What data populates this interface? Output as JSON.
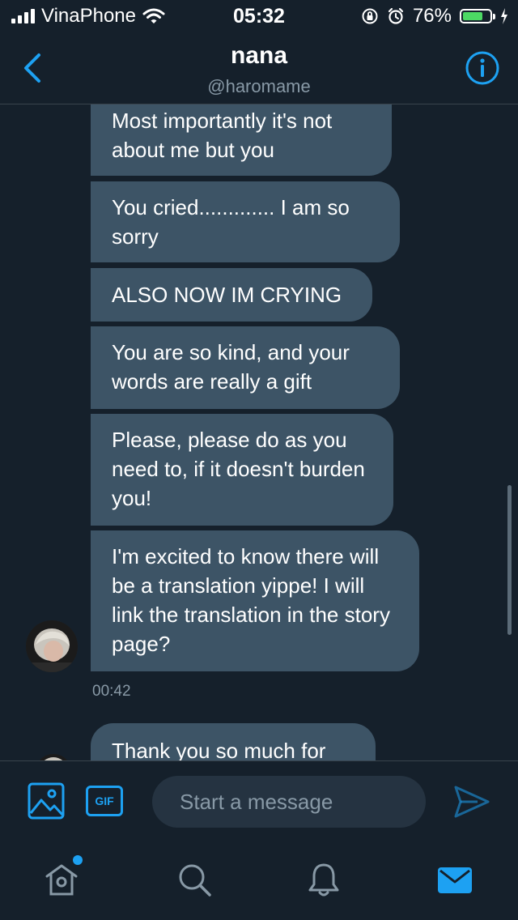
{
  "status_bar": {
    "carrier": "VinaPhone",
    "time": "05:32",
    "battery_percent": "76%",
    "battery_level": 0.76
  },
  "header": {
    "title": "nana",
    "handle": "@haromame"
  },
  "messages": [
    {
      "text": "Most importantly it's not about me but you"
    },
    {
      "text": "You cried............. I am so sorry"
    },
    {
      "text": "ALSO NOW IM CRYING"
    },
    {
      "text": "You are so kind, and your words are really a gift"
    },
    {
      "text": "Please, please do as you need to, if it doesn't burden you!"
    },
    {
      "text": "I'm excited to know there will be a translation yippe! I will link the translation in the story page?"
    },
    {
      "text": "Thank you so much for"
    }
  ],
  "timestamp": "00:42",
  "composer": {
    "placeholder": "Start a message",
    "gif_label": "GIF"
  },
  "colors": {
    "background": "#15202b",
    "bubble": "#3d5466",
    "accent": "#1da1f2",
    "muted_text": "#8899a6"
  },
  "icons": {
    "back": "chevron-left-icon",
    "info": "info-icon",
    "image": "image-icon",
    "gif": "gif-icon",
    "send": "send-icon",
    "home": "home-icon",
    "search": "search-icon",
    "notifications": "bell-icon",
    "messages": "mail-icon"
  }
}
